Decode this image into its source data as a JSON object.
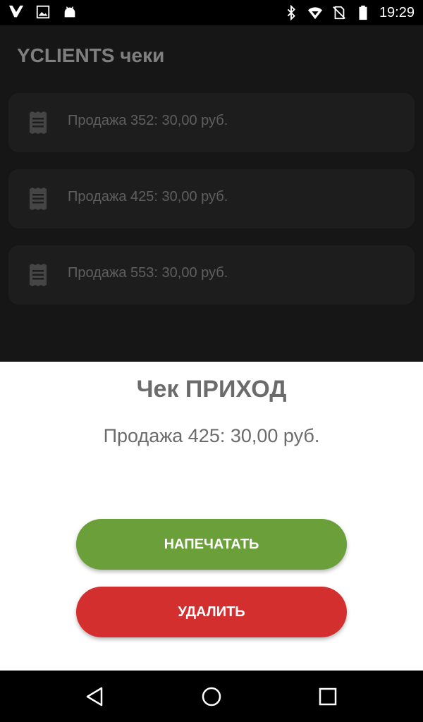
{
  "status_bar": {
    "time": "19:29",
    "left_icons": [
      "y-logo-icon",
      "image-icon",
      "android-icon"
    ],
    "right_icons": [
      "bluetooth-icon",
      "wifi-icon",
      "no-sim-icon",
      "battery-icon"
    ]
  },
  "app": {
    "title": "YCLIENTS чеки",
    "receipts": [
      {
        "label": "Продажа 352: 30,00 руб.",
        "icon": "receipt-icon"
      },
      {
        "label": "Продажа 425: 30,00 руб.",
        "icon": "receipt-icon"
      },
      {
        "label": "Продажа 553: 30,00 руб.",
        "icon": "receipt-icon"
      }
    ]
  },
  "sheet": {
    "title": "Чек ПРИХОД",
    "subtitle": "Продажа 425: 30,00 руб.",
    "print_label": "НАПЕЧАТАТЬ",
    "delete_label": "УДАЛИТЬ"
  },
  "nav_bar": {
    "icons": [
      "back-icon",
      "home-icon",
      "recents-icon"
    ]
  },
  "colors": {
    "background": "#2d2d2d",
    "card": "#3a3a3a",
    "print_button": "#6a9f39",
    "delete_button": "#d32f2f",
    "sheet_text": "#6b6b6b"
  }
}
